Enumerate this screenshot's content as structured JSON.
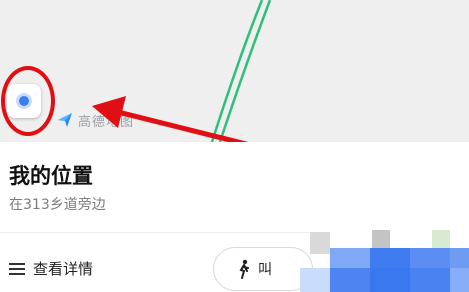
{
  "map": {
    "logo_text": "高德地图",
    "icons": {
      "locate": "locate-icon",
      "logo": "amap-logo-icon"
    },
    "road_color": "#2fbf7a"
  },
  "annotation": {
    "color": "#e00f14"
  },
  "location": {
    "title": "我的位置",
    "subtitle": "在313乡道旁边"
  },
  "actions": {
    "details_label": "查看详情",
    "walk_label": "叫"
  },
  "colors": {
    "accent_blue": "#3c7df2",
    "mosaic": [
      "#a9c8f5",
      "#5b8df2",
      "#3e7cf0",
      "#c9c9c9",
      "#cfe7c9"
    ]
  }
}
